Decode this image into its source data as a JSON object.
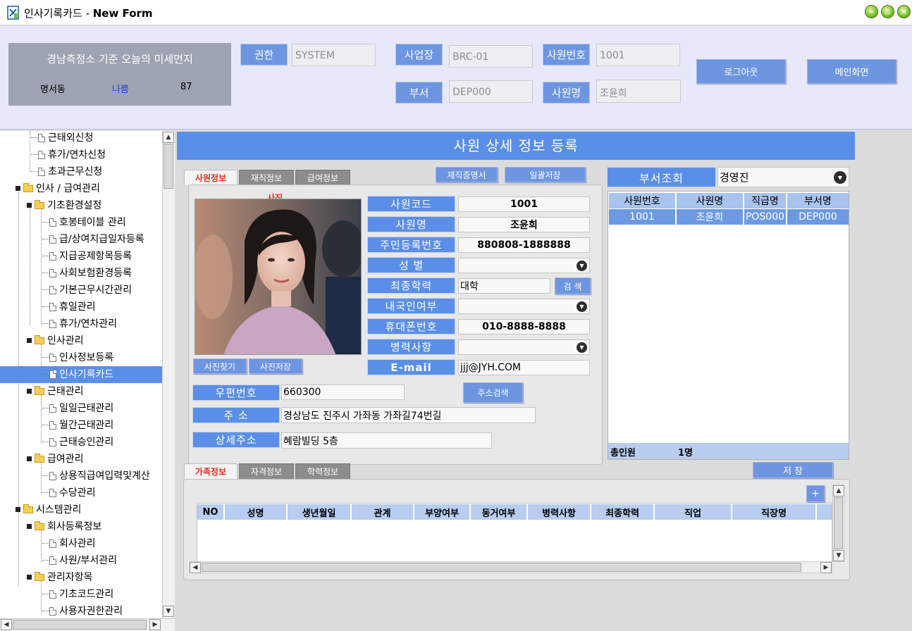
{
  "window": {
    "title_prefix": "인사기록카드 - ",
    "title_bold": "New Form",
    "buttons": [
      "minimize-icon",
      "maximize-icon",
      "close-icon"
    ]
  },
  "header": {
    "dust": {
      "title": "경남측정소 기준 오늘의 미세먼지",
      "area": "명서동",
      "status": "나쁨",
      "value": "87",
      "status_color": "#1f3fd8"
    },
    "permission_label": "권한",
    "permission_value": "SYSTEM",
    "site_label": "사업장",
    "site_value": "BRC-01",
    "dept_label": "부서",
    "dept_value": "DEP000",
    "emp_no_label": "사원번호",
    "emp_no_value": "1001",
    "emp_name_label": "사원명",
    "emp_name_value": "조윤희",
    "logout_label": "로그아웃",
    "main_label": "메인화면"
  },
  "tree": {
    "items": [
      {
        "label": "근태외신청",
        "kind": "doc"
      },
      {
        "label": "휴가/연차신청",
        "kind": "doc"
      },
      {
        "label": "초과근무신청",
        "kind": "doc"
      },
      {
        "label": "인사 / 급여관리",
        "kind": "folder"
      },
      {
        "label": "기초환경설정",
        "kind": "folder"
      },
      {
        "label": "호봉테이블 관리",
        "kind": "doc"
      },
      {
        "label": "급/상여지급일자등록",
        "kind": "doc"
      },
      {
        "label": "지급공제항목등록",
        "kind": "doc"
      },
      {
        "label": "사회보험환경등록",
        "kind": "doc"
      },
      {
        "label": "기본근무시간관리",
        "kind": "doc"
      },
      {
        "label": "휴일관리",
        "kind": "doc"
      },
      {
        "label": "휴가/연차관리",
        "kind": "doc"
      },
      {
        "label": "인사관리",
        "kind": "folder"
      },
      {
        "label": "인사정보등록",
        "kind": "doc"
      },
      {
        "label": "인사기록카드",
        "kind": "doc",
        "selected": true
      },
      {
        "label": "근태관리",
        "kind": "folder"
      },
      {
        "label": "일일근태관리",
        "kind": "doc"
      },
      {
        "label": "월간근태관리",
        "kind": "doc"
      },
      {
        "label": "근태승인관리",
        "kind": "doc"
      },
      {
        "label": "급여관리",
        "kind": "folder"
      },
      {
        "label": "상용직급여입력및계산",
        "kind": "doc"
      },
      {
        "label": "수당관리",
        "kind": "doc"
      },
      {
        "label": "시스템관리",
        "kind": "folder"
      },
      {
        "label": "회사등록정보",
        "kind": "folder"
      },
      {
        "label": "회사관리",
        "kind": "doc"
      },
      {
        "label": "사원/부서관리",
        "kind": "doc"
      },
      {
        "label": "관리자항목",
        "kind": "folder"
      },
      {
        "label": "기초코드관리",
        "kind": "doc"
      },
      {
        "label": "사용자권한관리",
        "kind": "doc"
      }
    ]
  },
  "main": {
    "banner": "사원 상세 정보 등록",
    "tabs_top": [
      "사원정보",
      "재직정보",
      "급여정보"
    ],
    "cert_button": "재직증명서",
    "save_all_button": "일괄저장",
    "photo_caption": "사진",
    "photo_find": "사진찾기",
    "photo_save": "사진저장",
    "fields": {
      "emp_code_label": "사원코드",
      "emp_code_value": "1001",
      "name_label": "사원명",
      "name_value": "조윤희",
      "rrn_label": "주민등록번호",
      "rrn_value": "880808-1888888",
      "gender_label": "성 별",
      "gender_value": "",
      "edu_label": "최종학력",
      "edu_value": "대학",
      "edu_search": "검 색",
      "nat_label": "내국인여부",
      "nat_value": "",
      "phone_label": "휴대폰번호",
      "phone_value": "010-8888-8888",
      "mil_label": "병력사항",
      "mil_value": "",
      "email_label": "E-mail",
      "email_value": "jjj@JYH.COM",
      "zip_label": "우편번호",
      "zip_value": "660300",
      "addr_search": "주소검색",
      "addr_label": "주 소",
      "addr_value": "경상남도 진주시 가좌동 가좌길74번길",
      "addr2_label": "상세주소",
      "addr2_value": "혜람빌딩 5층"
    },
    "dept_lookup_label": "부서조회",
    "dept_lookup_value": "경영진",
    "grid": {
      "headers": [
        "사원번호",
        "사원명",
        "직급명",
        "부서명"
      ],
      "rows": [
        [
          "1001",
          "조윤희",
          "POS000",
          "DEP000"
        ]
      ],
      "total_label": "총인원",
      "total_value": "1명"
    },
    "tabs_bottom": [
      "가족정보",
      "자격정보",
      "학력정보"
    ],
    "save_button": "저 장",
    "add_button": "+",
    "family_headers": [
      "NO",
      "성명",
      "생년월일",
      "관계",
      "부양여부",
      "동거여부",
      "병력사항",
      "최종학력",
      "직업",
      "직장명"
    ]
  }
}
